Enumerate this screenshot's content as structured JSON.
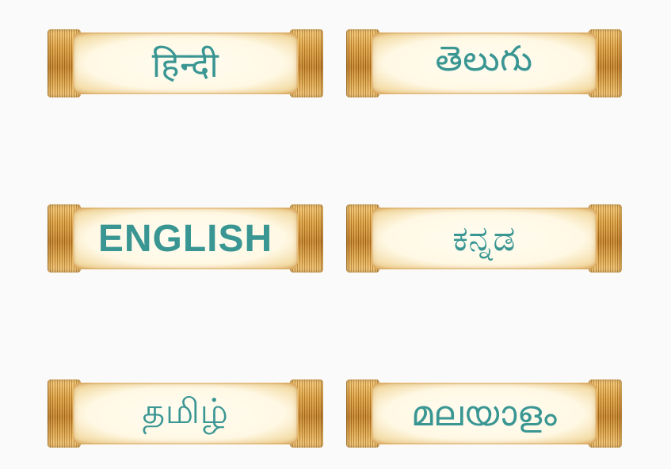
{
  "languages": [
    {
      "id": "hindi",
      "label": "हिन्दी"
    },
    {
      "id": "telugu",
      "label": "తెలుగు"
    },
    {
      "id": "english",
      "label": "ENGLISH"
    },
    {
      "id": "kannada",
      "label": "ಕನ್ನಡ"
    },
    {
      "id": "tamil",
      "label": "தமிழ்"
    },
    {
      "id": "malayalam",
      "label": "മലയാളം"
    }
  ],
  "colors": {
    "label_text": "#3a9693",
    "background": "#fafafa"
  }
}
